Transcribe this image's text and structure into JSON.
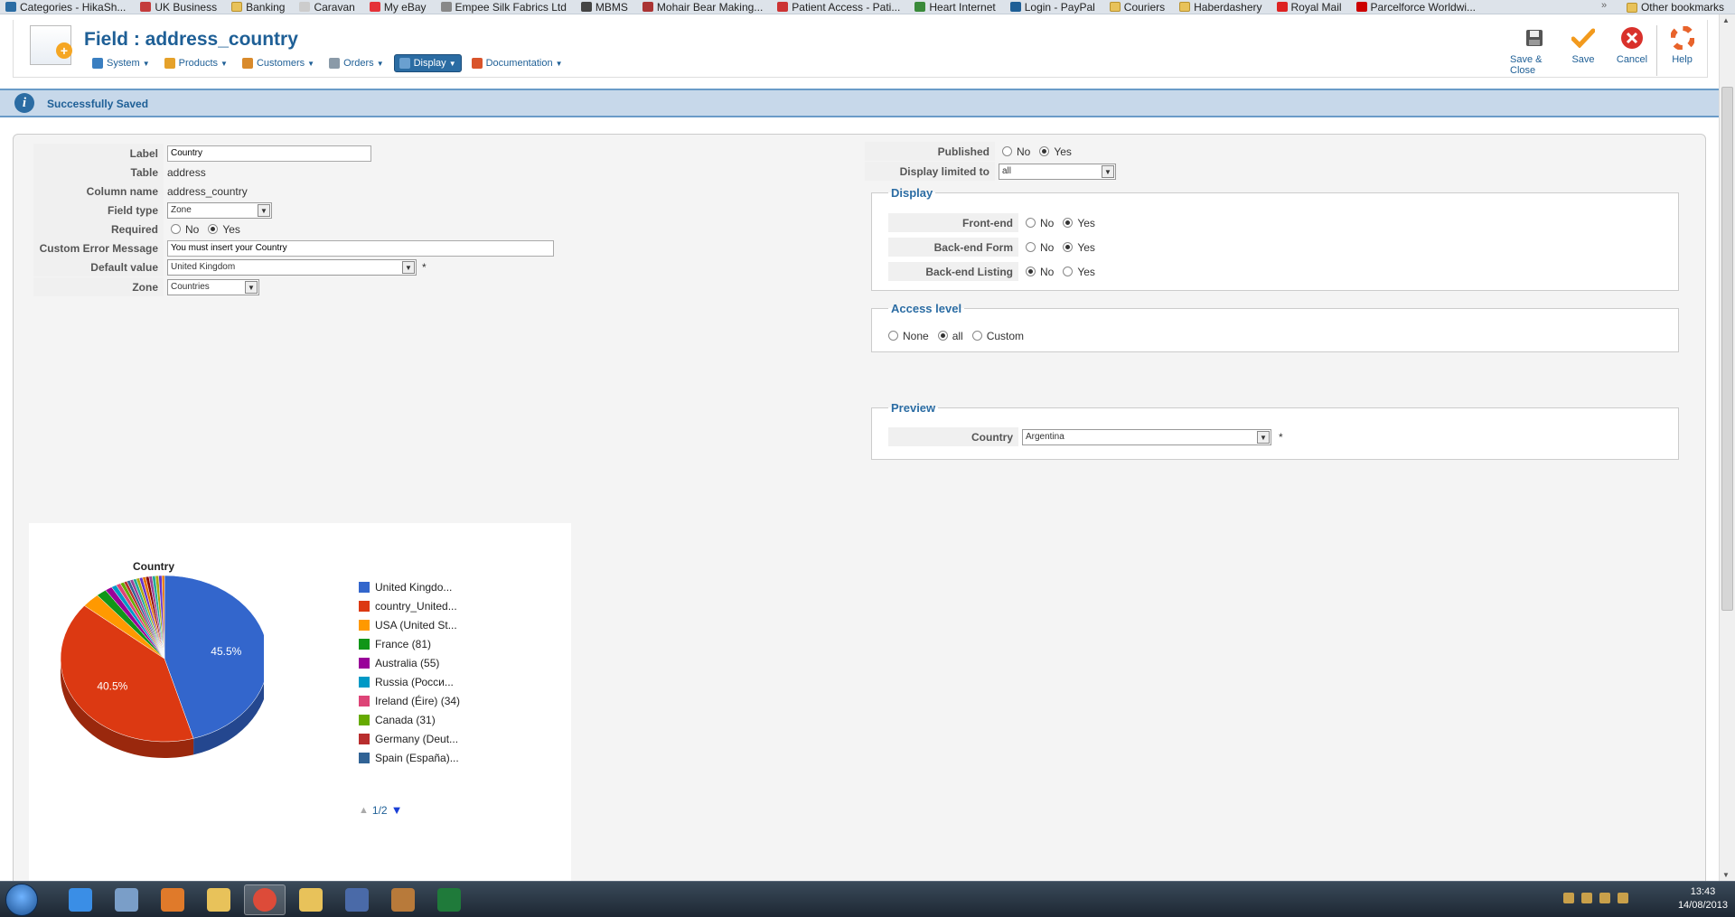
{
  "bookmarks": {
    "items": [
      {
        "label": "Categories - HikaSh...",
        "color": "#2b6ca3"
      },
      {
        "label": "UK Business",
        "color": "#c43c3c"
      },
      {
        "label": "Banking",
        "color": "folder"
      },
      {
        "label": "Caravan",
        "color": "#cccccc"
      },
      {
        "label": "My eBay",
        "color": "#e53238"
      },
      {
        "label": "Empee Silk Fabrics Ltd",
        "color": "#888888"
      },
      {
        "label": "MBMS",
        "color": "#444444"
      },
      {
        "label": "Mohair Bear Making...",
        "color": "#aa3333"
      },
      {
        "label": "Patient Access - Pati...",
        "color": "#cc3333"
      },
      {
        "label": "Heart Internet",
        "color": "#3a8a3a"
      },
      {
        "label": "Login - PayPal",
        "color": "#1e5f96"
      },
      {
        "label": "Couriers",
        "color": "folder"
      },
      {
        "label": "Haberdashery",
        "color": "folder"
      },
      {
        "label": "Royal Mail",
        "color": "#d22"
      },
      {
        "label": "Parcelforce Worldwi...",
        "color": "#c00"
      }
    ],
    "chevron": "»",
    "other": "Other bookmarks"
  },
  "header": {
    "title": "Field : address_country",
    "menu": [
      {
        "label": "System",
        "icon": "wrench-icon",
        "color": "#3a7fc1"
      },
      {
        "label": "Products",
        "icon": "box-icon",
        "color": "#e5a12a"
      },
      {
        "label": "Customers",
        "icon": "people-icon",
        "color": "#d98a2b"
      },
      {
        "label": "Orders",
        "icon": "orders-icon",
        "color": "#8a9aa8"
      },
      {
        "label": "Display",
        "icon": "display-icon",
        "color": "#6aa0d0"
      },
      {
        "label": "Documentation",
        "icon": "lifebuoy-icon",
        "color": "#d9542b"
      }
    ],
    "toolbar": {
      "save_close": "Save & Close",
      "save": "Save",
      "cancel": "Cancel",
      "help": "Help"
    }
  },
  "message": {
    "text": "Successfully Saved",
    "icon": "info-icon"
  },
  "form": {
    "label": {
      "label": "Label",
      "value": "Country"
    },
    "table": {
      "label": "Table",
      "value": "address"
    },
    "column": {
      "label": "Column name",
      "value": "address_country"
    },
    "field_type": {
      "label": "Field type",
      "value": "Zone"
    },
    "required": {
      "label": "Required",
      "no": "No",
      "yes": "Yes",
      "selected": "Yes"
    },
    "custom_error": {
      "label": "Custom Error Message",
      "value": "You must insert your Country"
    },
    "default_value": {
      "label": "Default value",
      "value": "United Kingdom",
      "asterisk": "*"
    },
    "zone": {
      "label": "Zone",
      "value": "Countries"
    }
  },
  "right": {
    "published": {
      "label": "Published",
      "no": "No",
      "yes": "Yes",
      "selected": "Yes"
    },
    "display_limited": {
      "label": "Display limited to",
      "value": "all"
    },
    "display": {
      "legend": "Display",
      "frontend": {
        "label": "Front-end",
        "no": "No",
        "yes": "Yes",
        "selected": "Yes"
      },
      "backend_form": {
        "label": "Back-end Form",
        "no": "No",
        "yes": "Yes",
        "selected": "Yes"
      },
      "backend_listing": {
        "label": "Back-end Listing",
        "no": "No",
        "yes": "Yes",
        "selected": "No"
      }
    },
    "access": {
      "legend": "Access level",
      "none": "None",
      "all": "all",
      "custom": "Custom",
      "selected": "all"
    },
    "preview": {
      "legend": "Preview",
      "label": "Country",
      "value": "Argentina",
      "asterisk": "*"
    }
  },
  "chart_data": {
    "type": "pie",
    "title": "Country",
    "categories": [
      "United Kingdo...",
      "country_United...",
      "USA (United St...",
      "France (81)",
      "Australia (55)",
      "Russia (Росси...",
      "Ireland (Éire) (34)",
      "Canada (31)",
      "Germany (Deut...",
      "Spain (España)..."
    ],
    "values": [
      45.5,
      40.5,
      2.8,
      1.6,
      1.1,
      0.8,
      0.7,
      0.6,
      0.5,
      0.5
    ],
    "colors": [
      "#3366cc",
      "#dc3912",
      "#ff9900",
      "#109618",
      "#990099",
      "#0099c6",
      "#dd4477",
      "#66aa00",
      "#b82e2e",
      "#316395"
    ],
    "labels_shown": [
      "45.5%",
      "40.5%"
    ],
    "pager": {
      "text": "1/2",
      "up": "▲",
      "down": "▼"
    },
    "legend_position": "right",
    "style": "3d"
  },
  "taskbar": {
    "time": "13:43",
    "date": "14/08/2013",
    "apps": [
      {
        "name": "ie-icon",
        "color": "#3a8ee6"
      },
      {
        "name": "paint-icon",
        "color": "#7a9ec8"
      },
      {
        "name": "media-player-icon",
        "color": "#e07a2a"
      },
      {
        "name": "explorer-icon",
        "color": "#e8c25a"
      },
      {
        "name": "chrome-icon",
        "color": "#dd4b39"
      },
      {
        "name": "outlook-icon",
        "color": "#e8c25a"
      },
      {
        "name": "photo-viewer-icon",
        "color": "#4a6aa8"
      },
      {
        "name": "scanner-icon",
        "color": "#b87a3a"
      },
      {
        "name": "excel-icon",
        "color": "#1f7a3a"
      }
    ]
  }
}
